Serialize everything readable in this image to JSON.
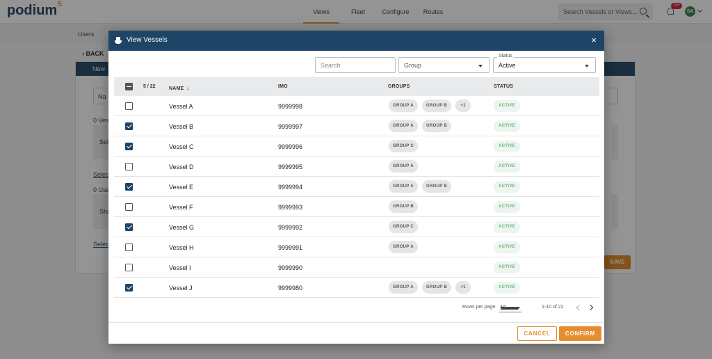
{
  "app": {
    "logo": "podium",
    "logo_version": "5"
  },
  "nav": [
    "Views",
    "Fleet",
    "Configure",
    "Routes"
  ],
  "top_search": {
    "placeholder": "Search Vessels or Views..."
  },
  "notifications": {
    "badge": "10+"
  },
  "user": {
    "initials": "SA"
  },
  "breadcrumb": "Users",
  "back_label": "BACK",
  "background_card": {
    "title": "New",
    "field_label": "Na",
    "vessels_count": "0 Ves",
    "vessels_placeholder": "Sele",
    "vessels_link": "Select",
    "users_count": "0 Use",
    "users_placeholder": "Sha",
    "users_link": "Select",
    "save_label": "SAVE"
  },
  "modal": {
    "title": "View Vessels",
    "close_label": "×",
    "filters": {
      "search_placeholder": "Search",
      "group_value": "Group",
      "status_legend": "Status",
      "status_value": "Active"
    },
    "table": {
      "selected_count": "5 / 22",
      "columns": {
        "name": "NAME",
        "imo": "IMO",
        "groups": "GROUPS",
        "status": "STATUS"
      },
      "rows": [
        {
          "checked": false,
          "name": "Vessel A",
          "imo": "9999998",
          "groups": [
            "GROUP A",
            "GROUP B"
          ],
          "more": "+1",
          "status": "ACTIVE"
        },
        {
          "checked": true,
          "name": "Vessel B",
          "imo": "9999997",
          "groups": [
            "GROUP A",
            "GROUP B"
          ],
          "more": "",
          "status": "ACTIVE"
        },
        {
          "checked": true,
          "name": "Vessel C",
          "imo": "9999996",
          "groups": [
            "GROUP C"
          ],
          "more": "",
          "status": "ACTIVE"
        },
        {
          "checked": false,
          "name": "Vessel D",
          "imo": "9999995",
          "groups": [
            "GROUP A"
          ],
          "more": "",
          "status": "ACTIVE"
        },
        {
          "checked": true,
          "name": "Vessel E",
          "imo": "9999994",
          "groups": [
            "GROUP A",
            "GROUP B"
          ],
          "more": "",
          "status": "ACTIVE"
        },
        {
          "checked": false,
          "name": "Vessel F",
          "imo": "9999993",
          "groups": [
            "GROUP B"
          ],
          "more": "",
          "status": "ACTIVE"
        },
        {
          "checked": true,
          "name": "Vessel G",
          "imo": "9999992",
          "groups": [
            "GROUP C"
          ],
          "more": "",
          "status": "ACTIVE"
        },
        {
          "checked": false,
          "name": "Vessel H",
          "imo": "9999991",
          "groups": [
            "GROUP A"
          ],
          "more": "",
          "status": "ACTIVE"
        },
        {
          "checked": false,
          "name": "Vessel I",
          "imo": "9999990",
          "groups": [],
          "more": "",
          "status": "ACTIVE"
        },
        {
          "checked": true,
          "name": "Vessel J",
          "imo": "9999980",
          "groups": [
            "GROUP A",
            "GROUP B"
          ],
          "more": "+1",
          "status": "ACTIVE"
        }
      ]
    },
    "pagination": {
      "rows_per_page_label": "Rows per page:",
      "rows_per_page": "10",
      "range": "1-10 of 22"
    },
    "cancel_label": "CANCEL",
    "confirm_label": "CONFIRM"
  },
  "colors": {
    "brand": "#1e4566",
    "accent": "#e58e2f",
    "status_green": "#6cb07a"
  }
}
